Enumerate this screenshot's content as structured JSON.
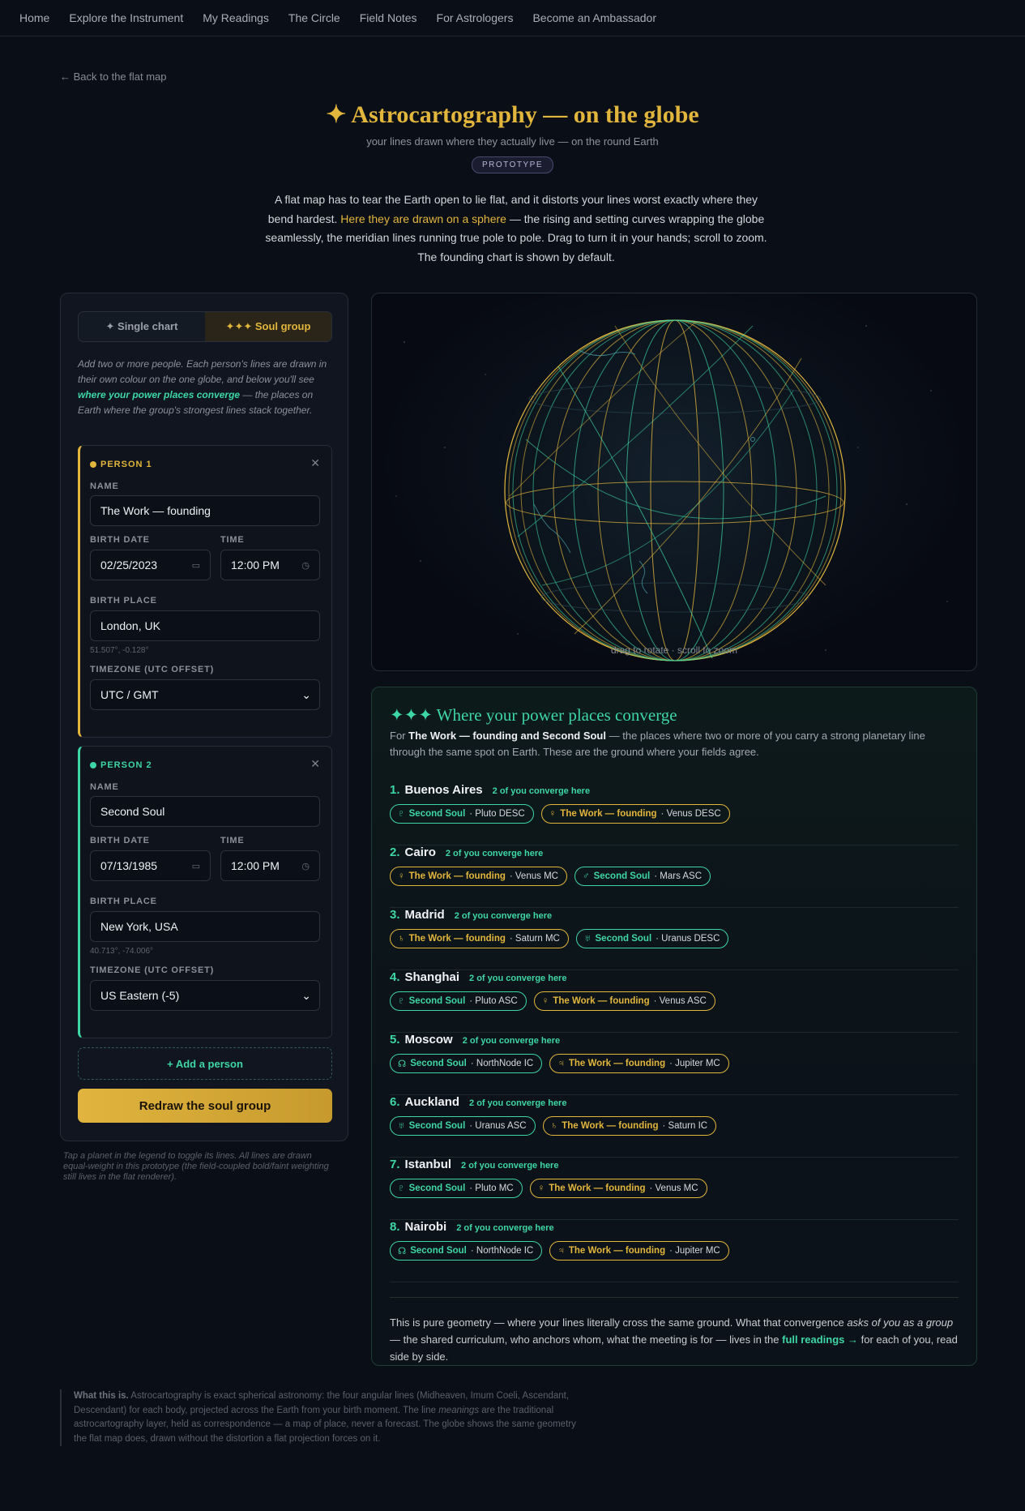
{
  "nav": [
    "Home",
    "Explore the Instrument",
    "My Readings",
    "The Circle",
    "Field Notes",
    "For Astrologers",
    "Become an Ambassador"
  ],
  "back_link": "← Back to the flat map",
  "title": "✦ Astrocartography — on the globe",
  "subtitle": "your lines drawn where they actually live — on the round Earth",
  "badge": "PROTOTYPE",
  "intro": {
    "a": "A flat map has to tear the Earth open to lie flat, and it distorts your lines worst exactly where they bend hardest. ",
    "hl": "Here they are drawn on a sphere",
    "b": " — the rising and setting curves wrapping the globe seamlessly, the meridian lines running true pole to pole. Drag to turn it in your hands; scroll to zoom. The founding chart is shown by default."
  },
  "toggle": {
    "single": "✦ Single chart",
    "soul": "✦✦✦ Soul group"
  },
  "helper": {
    "a": "Add two or more people. Each person's lines are drawn in their own colour on the one globe, and below you'll see ",
    "hl": "where your power places converge",
    "b": " — the places on Earth where the group's strongest lines stack together."
  },
  "labels": {
    "name": "NAME",
    "birth_date": "BIRTH DATE",
    "time": "TIME",
    "birth_place": "BIRTH PLACE",
    "timezone": "TIMEZONE (UTC OFFSET)"
  },
  "people": [
    {
      "header": "PERSON 1",
      "name": "The Work — founding",
      "date": "02/25/2023",
      "time": "12:00 PM",
      "place": "London, UK",
      "coords": "51.507°, -0.128°",
      "tz": "UTC / GMT"
    },
    {
      "header": "PERSON 2",
      "name": "Second Soul",
      "date": "07/13/1985",
      "time": "12:00 PM",
      "place": "New York, USA",
      "coords": "40.713°, -74.006°",
      "tz": "US Eastern (-5)"
    }
  ],
  "add_person": "+ Add a person",
  "redraw": "Redraw the soul group",
  "legend_note": "Tap a planet in the legend to toggle its lines. All lines are drawn equal-weight in this prototype (the field-coupled bold/faint weighting still lives in the flat renderer).",
  "globe_caption": "drag to rotate · scroll to zoom",
  "colors": {
    "gold": "#e2b53c",
    "teal": "#3ed6a4",
    "bg": "#0a0e17"
  },
  "converge": {
    "title": "✦✦✦ Where your power places converge",
    "desc_a": "For ",
    "desc_b": "The Work — founding and Second Soul",
    "desc_c": " — the places where two or more of you carry a strong planetary line through the same spot on Earth. These are the ground where your fields agree.",
    "count_label": "2 of you converge here",
    "places": [
      {
        "num": "1.",
        "city": "Buenos Aires",
        "tags": [
          {
            "c": "t",
            "glyph": "♇",
            "who": "Second Soul",
            "line": "· Pluto DESC"
          },
          {
            "c": "g",
            "glyph": "♀",
            "who": "The Work — founding",
            "line": "· Venus DESC"
          }
        ]
      },
      {
        "num": "2.",
        "city": "Cairo",
        "tags": [
          {
            "c": "g",
            "glyph": "♀",
            "who": "The Work — founding",
            "line": "· Venus MC"
          },
          {
            "c": "t",
            "glyph": "♂",
            "who": "Second Soul",
            "line": "· Mars ASC"
          }
        ]
      },
      {
        "num": "3.",
        "city": "Madrid",
        "tags": [
          {
            "c": "g",
            "glyph": "♄",
            "who": "The Work — founding",
            "line": "· Saturn MC"
          },
          {
            "c": "t",
            "glyph": "♅",
            "who": "Second Soul",
            "line": "· Uranus DESC"
          }
        ]
      },
      {
        "num": "4.",
        "city": "Shanghai",
        "tags": [
          {
            "c": "t",
            "glyph": "♇",
            "who": "Second Soul",
            "line": "· Pluto ASC"
          },
          {
            "c": "g",
            "glyph": "♀",
            "who": "The Work — founding",
            "line": "· Venus ASC"
          }
        ]
      },
      {
        "num": "5.",
        "city": "Moscow",
        "tags": [
          {
            "c": "t",
            "glyph": "☊",
            "who": "Second Soul",
            "line": "· NorthNode IC"
          },
          {
            "c": "g",
            "glyph": "♃",
            "who": "The Work — founding",
            "line": "· Jupiter MC"
          }
        ]
      },
      {
        "num": "6.",
        "city": "Auckland",
        "tags": [
          {
            "c": "t",
            "glyph": "♅",
            "who": "Second Soul",
            "line": "· Uranus ASC"
          },
          {
            "c": "g",
            "glyph": "♄",
            "who": "The Work — founding",
            "line": "· Saturn IC"
          }
        ]
      },
      {
        "num": "7.",
        "city": "Istanbul",
        "tags": [
          {
            "c": "t",
            "glyph": "♇",
            "who": "Second Soul",
            "line": "· Pluto MC"
          },
          {
            "c": "g",
            "glyph": "♀",
            "who": "The Work — founding",
            "line": "· Venus MC"
          }
        ]
      },
      {
        "num": "8.",
        "city": "Nairobi",
        "tags": [
          {
            "c": "t",
            "glyph": "☊",
            "who": "Second Soul",
            "line": "· NorthNode IC"
          },
          {
            "c": "g",
            "glyph": "♃",
            "who": "The Work — founding",
            "line": "· Jupiter MC"
          }
        ]
      }
    ],
    "foot_a": "This is pure geometry — where your lines literally cross the same ground. What that convergence ",
    "foot_em": "asks of you as a group",
    "foot_b": " — the shared curriculum, who anchors whom, what the meeting is for — lives in the ",
    "foot_link": "full readings →",
    "foot_c": " for each of you, read side by side."
  },
  "what": {
    "bold": "What this is.",
    "a": " Astrocartography is exact spherical astronomy: the four angular lines (Midheaven, Imum Coeli, Ascendant, Descendant) for each body, projected across the Earth from your birth moment. The line ",
    "em": "meanings",
    "b": " are the traditional astrocartography layer, held as correspondence — a map of place, never a forecast. The globe shows the same geometry the flat map does, drawn without the distortion a flat projection forces on it."
  }
}
